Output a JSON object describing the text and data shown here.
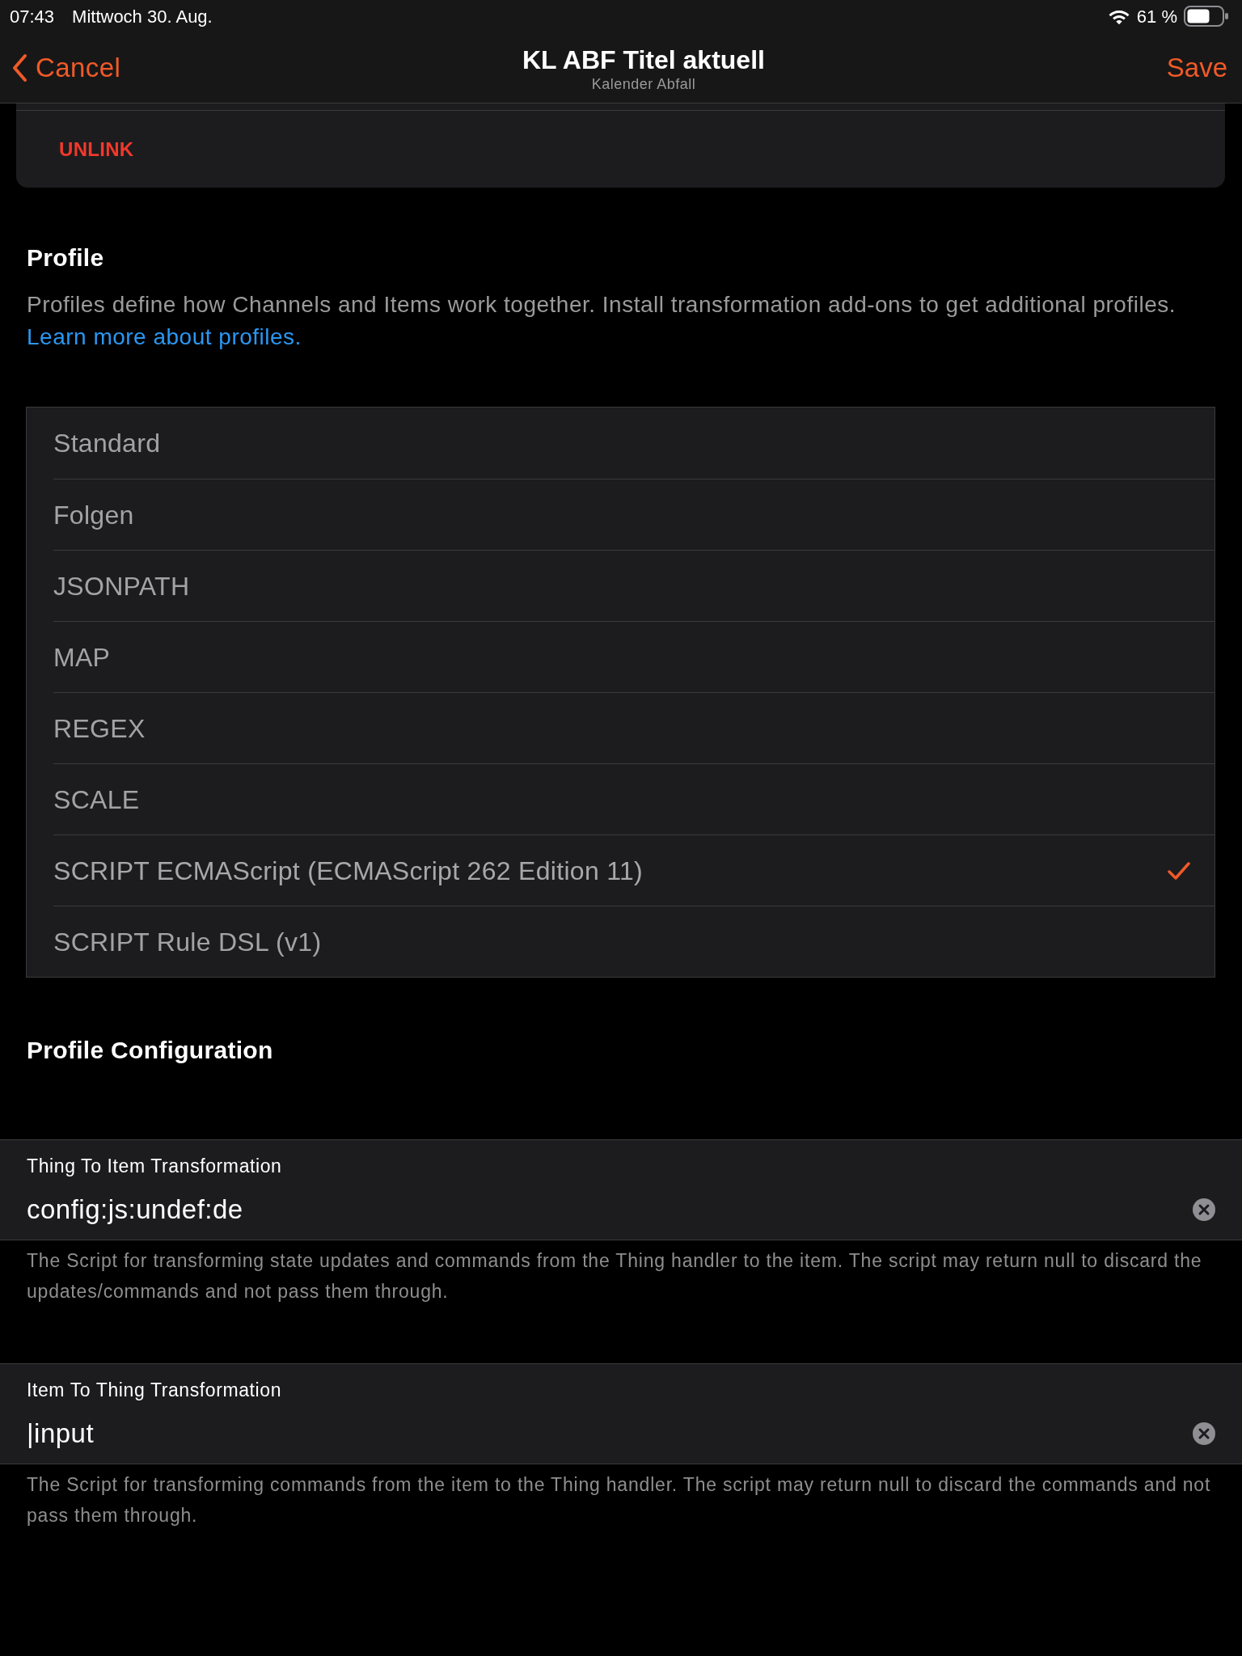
{
  "status_bar": {
    "time": "07:43",
    "date": "Mittwoch 30. Aug.",
    "battery": "61 %"
  },
  "nav": {
    "back": "Cancel",
    "title": "KL ABF Titel aktuell",
    "subtitle": "Kalender Abfall",
    "action": "Save"
  },
  "link_card": {
    "action": "UNLINK"
  },
  "profile": {
    "heading": "Profile",
    "description": "Profiles define how Channels and Items work together. Install transformation add-ons to get additional profiles.",
    "link": "Learn more about profiles.",
    "options": [
      {
        "label": "Standard",
        "selected": false
      },
      {
        "label": "Folgen",
        "selected": false
      },
      {
        "label": "JSONPATH",
        "selected": false
      },
      {
        "label": "MAP",
        "selected": false
      },
      {
        "label": "REGEX",
        "selected": false
      },
      {
        "label": "SCALE",
        "selected": false
      },
      {
        "label": "SCRIPT ECMAScript (ECMAScript 262 Edition 11)",
        "selected": true
      },
      {
        "label": "SCRIPT Rule DSL (v1)",
        "selected": false
      }
    ]
  },
  "configuration": {
    "heading": "Profile Configuration",
    "fields": [
      {
        "label": "Thing To Item Transformation",
        "value": "config:js:undef:de",
        "help": "The Script for transforming state updates and commands from the Thing handler to the item. The script may return null to discard the updates/commands and not pass them through."
      },
      {
        "label": "Item To Thing Transformation",
        "value": "|input",
        "help": "The Script for transforming commands from the item to the Thing handler. The script may return null to discard the commands and not pass them through."
      }
    ]
  }
}
